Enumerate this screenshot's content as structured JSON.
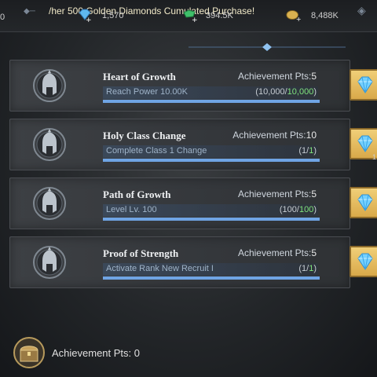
{
  "topbar": {
    "left_value": "0",
    "marquee": "/her 500 Golden Diamonds Cumulated Purchase!",
    "currencies": [
      {
        "icon": "blue-diamond-plus-icon",
        "value": "1,570"
      },
      {
        "icon": "green-gem-plus-icon",
        "value": "394.5K"
      },
      {
        "icon": "gold-coin-plus-icon",
        "value": "8,488K"
      }
    ]
  },
  "achievements": [
    {
      "title": "Heart of Growth",
      "pts_label": "Achievement Pts:",
      "pts": "5",
      "desc": "Reach Power 10.00K",
      "prog_open": "(10,000/",
      "prog_target": "10,000",
      "prog_close": ")",
      "progress": 1.0,
      "reward_count": ""
    },
    {
      "title": "Holy Class Change",
      "pts_label": "Achievement Pts:",
      "pts": "10",
      "desc": "Complete Class 1 Change",
      "prog_open": "(1/",
      "prog_target": "1",
      "prog_close": ")",
      "progress": 1.0,
      "reward_count": "1"
    },
    {
      "title": "Path of Growth",
      "pts_label": "Achievement Pts:",
      "pts": "5",
      "desc": "Level Lv. 100",
      "prog_open": "(100/",
      "prog_target": "100",
      "prog_close": ")",
      "progress": 1.0,
      "reward_count": ""
    },
    {
      "title": "Proof of Strength",
      "pts_label": "Achievement Pts:",
      "pts": "5",
      "desc": "Activate Rank New Recruit I",
      "prog_open": "(1/",
      "prog_target": "1",
      "prog_close": ")",
      "progress": 1.0,
      "reward_count": ""
    }
  ],
  "footer": {
    "label": "Achievement Pts: 0",
    "icon": "treasure-chest-icon"
  },
  "colors": {
    "bar_fill": "#6fa4e4",
    "progress_done": "#7fe27c",
    "reward_bg": "#e2b65c"
  }
}
